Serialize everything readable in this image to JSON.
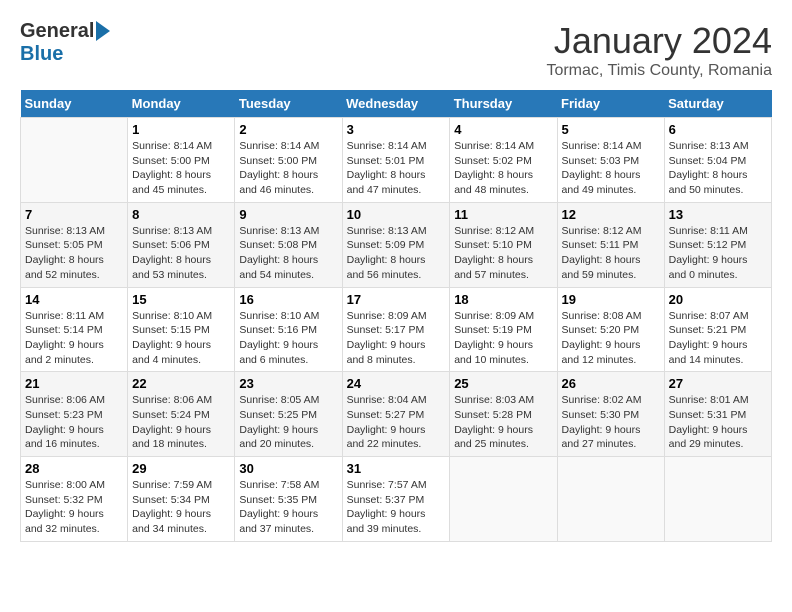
{
  "logo": {
    "general": "General",
    "blue": "Blue"
  },
  "title": "January 2024",
  "location": "Tormac, Timis County, Romania",
  "days_of_week": [
    "Sunday",
    "Monday",
    "Tuesday",
    "Wednesday",
    "Thursday",
    "Friday",
    "Saturday"
  ],
  "weeks": [
    [
      {
        "day": "",
        "sunrise": "",
        "sunset": "",
        "daylight": ""
      },
      {
        "day": "1",
        "sunrise": "Sunrise: 8:14 AM",
        "sunset": "Sunset: 5:00 PM",
        "daylight": "Daylight: 8 hours and 45 minutes."
      },
      {
        "day": "2",
        "sunrise": "Sunrise: 8:14 AM",
        "sunset": "Sunset: 5:00 PM",
        "daylight": "Daylight: 8 hours and 46 minutes."
      },
      {
        "day": "3",
        "sunrise": "Sunrise: 8:14 AM",
        "sunset": "Sunset: 5:01 PM",
        "daylight": "Daylight: 8 hours and 47 minutes."
      },
      {
        "day": "4",
        "sunrise": "Sunrise: 8:14 AM",
        "sunset": "Sunset: 5:02 PM",
        "daylight": "Daylight: 8 hours and 48 minutes."
      },
      {
        "day": "5",
        "sunrise": "Sunrise: 8:14 AM",
        "sunset": "Sunset: 5:03 PM",
        "daylight": "Daylight: 8 hours and 49 minutes."
      },
      {
        "day": "6",
        "sunrise": "Sunrise: 8:13 AM",
        "sunset": "Sunset: 5:04 PM",
        "daylight": "Daylight: 8 hours and 50 minutes."
      }
    ],
    [
      {
        "day": "7",
        "sunrise": "Sunrise: 8:13 AM",
        "sunset": "Sunset: 5:05 PM",
        "daylight": "Daylight: 8 hours and 52 minutes."
      },
      {
        "day": "8",
        "sunrise": "Sunrise: 8:13 AM",
        "sunset": "Sunset: 5:06 PM",
        "daylight": "Daylight: 8 hours and 53 minutes."
      },
      {
        "day": "9",
        "sunrise": "Sunrise: 8:13 AM",
        "sunset": "Sunset: 5:08 PM",
        "daylight": "Daylight: 8 hours and 54 minutes."
      },
      {
        "day": "10",
        "sunrise": "Sunrise: 8:13 AM",
        "sunset": "Sunset: 5:09 PM",
        "daylight": "Daylight: 8 hours and 56 minutes."
      },
      {
        "day": "11",
        "sunrise": "Sunrise: 8:12 AM",
        "sunset": "Sunset: 5:10 PM",
        "daylight": "Daylight: 8 hours and 57 minutes."
      },
      {
        "day": "12",
        "sunrise": "Sunrise: 8:12 AM",
        "sunset": "Sunset: 5:11 PM",
        "daylight": "Daylight: 8 hours and 59 minutes."
      },
      {
        "day": "13",
        "sunrise": "Sunrise: 8:11 AM",
        "sunset": "Sunset: 5:12 PM",
        "daylight": "Daylight: 9 hours and 0 minutes."
      }
    ],
    [
      {
        "day": "14",
        "sunrise": "Sunrise: 8:11 AM",
        "sunset": "Sunset: 5:14 PM",
        "daylight": "Daylight: 9 hours and 2 minutes."
      },
      {
        "day": "15",
        "sunrise": "Sunrise: 8:10 AM",
        "sunset": "Sunset: 5:15 PM",
        "daylight": "Daylight: 9 hours and 4 minutes."
      },
      {
        "day": "16",
        "sunrise": "Sunrise: 8:10 AM",
        "sunset": "Sunset: 5:16 PM",
        "daylight": "Daylight: 9 hours and 6 minutes."
      },
      {
        "day": "17",
        "sunrise": "Sunrise: 8:09 AM",
        "sunset": "Sunset: 5:17 PM",
        "daylight": "Daylight: 9 hours and 8 minutes."
      },
      {
        "day": "18",
        "sunrise": "Sunrise: 8:09 AM",
        "sunset": "Sunset: 5:19 PM",
        "daylight": "Daylight: 9 hours and 10 minutes."
      },
      {
        "day": "19",
        "sunrise": "Sunrise: 8:08 AM",
        "sunset": "Sunset: 5:20 PM",
        "daylight": "Daylight: 9 hours and 12 minutes."
      },
      {
        "day": "20",
        "sunrise": "Sunrise: 8:07 AM",
        "sunset": "Sunset: 5:21 PM",
        "daylight": "Daylight: 9 hours and 14 minutes."
      }
    ],
    [
      {
        "day": "21",
        "sunrise": "Sunrise: 8:06 AM",
        "sunset": "Sunset: 5:23 PM",
        "daylight": "Daylight: 9 hours and 16 minutes."
      },
      {
        "day": "22",
        "sunrise": "Sunrise: 8:06 AM",
        "sunset": "Sunset: 5:24 PM",
        "daylight": "Daylight: 9 hours and 18 minutes."
      },
      {
        "day": "23",
        "sunrise": "Sunrise: 8:05 AM",
        "sunset": "Sunset: 5:25 PM",
        "daylight": "Daylight: 9 hours and 20 minutes."
      },
      {
        "day": "24",
        "sunrise": "Sunrise: 8:04 AM",
        "sunset": "Sunset: 5:27 PM",
        "daylight": "Daylight: 9 hours and 22 minutes."
      },
      {
        "day": "25",
        "sunrise": "Sunrise: 8:03 AM",
        "sunset": "Sunset: 5:28 PM",
        "daylight": "Daylight: 9 hours and 25 minutes."
      },
      {
        "day": "26",
        "sunrise": "Sunrise: 8:02 AM",
        "sunset": "Sunset: 5:30 PM",
        "daylight": "Daylight: 9 hours and 27 minutes."
      },
      {
        "day": "27",
        "sunrise": "Sunrise: 8:01 AM",
        "sunset": "Sunset: 5:31 PM",
        "daylight": "Daylight: 9 hours and 29 minutes."
      }
    ],
    [
      {
        "day": "28",
        "sunrise": "Sunrise: 8:00 AM",
        "sunset": "Sunset: 5:32 PM",
        "daylight": "Daylight: 9 hours and 32 minutes."
      },
      {
        "day": "29",
        "sunrise": "Sunrise: 7:59 AM",
        "sunset": "Sunset: 5:34 PM",
        "daylight": "Daylight: 9 hours and 34 minutes."
      },
      {
        "day": "30",
        "sunrise": "Sunrise: 7:58 AM",
        "sunset": "Sunset: 5:35 PM",
        "daylight": "Daylight: 9 hours and 37 minutes."
      },
      {
        "day": "31",
        "sunrise": "Sunrise: 7:57 AM",
        "sunset": "Sunset: 5:37 PM",
        "daylight": "Daylight: 9 hours and 39 minutes."
      },
      {
        "day": "",
        "sunrise": "",
        "sunset": "",
        "daylight": ""
      },
      {
        "day": "",
        "sunrise": "",
        "sunset": "",
        "daylight": ""
      },
      {
        "day": "",
        "sunrise": "",
        "sunset": "",
        "daylight": ""
      }
    ]
  ]
}
